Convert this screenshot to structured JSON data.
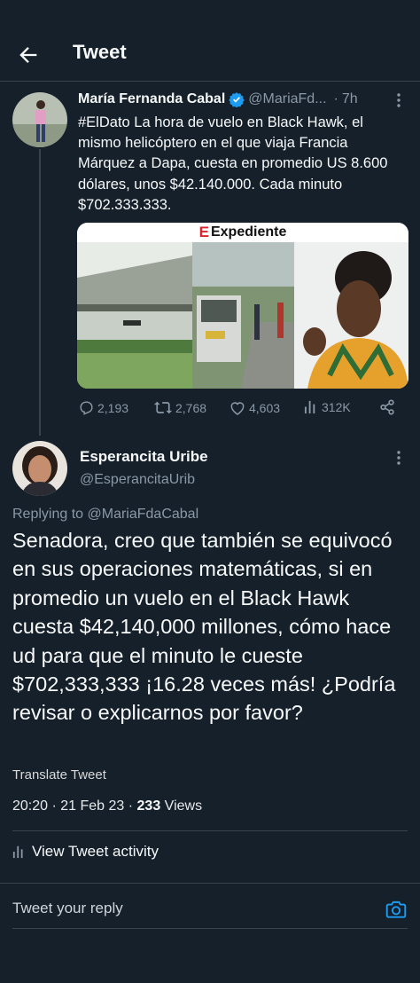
{
  "header": {
    "title": "Tweet"
  },
  "tweet1": {
    "author_name": "María Fernanda Cabal",
    "handle": "@MariaFd...",
    "separator": "·",
    "time": "7h",
    "text": "#ElDato La hora de vuelo en  Black Hawk, el mismo helicóptero en el que viaja Francia Márquez a Dapa, cuesta en promedio US 8.600 dólares, unos $42.140.000. Cada minuto $702.333.333.",
    "media_logo_mark": "E",
    "media_logo_text": "Expediente",
    "stats": {
      "replies": "2,193",
      "retweets": "2,768",
      "likes": "4,603",
      "views": "312K"
    }
  },
  "tweet2": {
    "author_name": "Esperancita Uribe",
    "handle": "@EsperancitaUrib",
    "replying_prefix": "Replying to",
    "replying_to": "@MariaFdaCabal",
    "text": "Senadora, creo que también se equivocó en sus operaciones matemáticas, si en promedio un vuelo en el Black Hawk cuesta $42,140,000 millones, cómo hace ud para que el minuto le cueste $702,333,333 ¡16.28 veces más! ¿Podría revisar o explicarnos por favor?",
    "translate_label": "Translate Tweet",
    "timestamp": "20:20 · 21 Feb 23 · ",
    "views_count": "233",
    "views_label": " Views"
  },
  "activity": {
    "label": "View Tweet activity"
  },
  "reply": {
    "placeholder": "Tweet your reply"
  },
  "colors": {
    "background": "#15202b",
    "muted": "#8b98a5",
    "accent": "#1d9bf0",
    "divider": "#38444d"
  },
  "icons": [
    "back-arrow-icon",
    "verified-icon",
    "more-icon",
    "reply-icon",
    "retweet-icon",
    "like-icon",
    "views-icon",
    "share-icon",
    "analytics-icon",
    "camera-icon"
  ]
}
